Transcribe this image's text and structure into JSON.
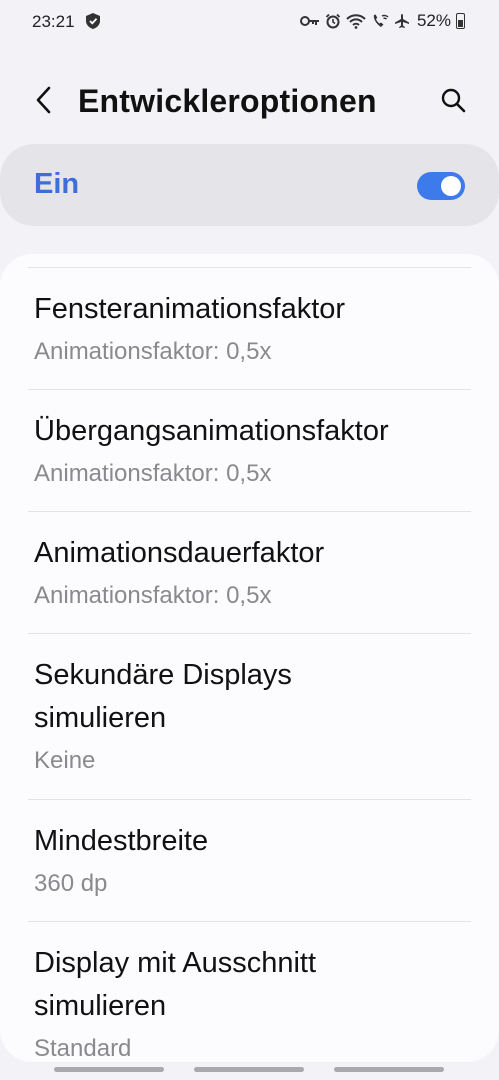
{
  "status_bar": {
    "time": "23:21",
    "battery": "52%",
    "icons": [
      "shield-icon",
      "key-icon",
      "alarm-icon",
      "wifi-icon",
      "wifi-call-icon",
      "airplane-icon",
      "battery-icon"
    ]
  },
  "header": {
    "title": "Entwickleroptionen",
    "back_icon": "chevron-left-icon",
    "search_icon": "search-icon"
  },
  "master_switch": {
    "label": "Ein",
    "state": "on",
    "accent_color": "#3e7bea"
  },
  "settings": [
    {
      "title": "Fensteranimationsfaktor",
      "subtitle": "Animationsfaktor: 0,5x"
    },
    {
      "title": "Übergangsanimationsfaktor",
      "subtitle": "Animationsfaktor: 0,5x"
    },
    {
      "title": "Animationsdauerfaktor",
      "subtitle": "Animationsfaktor: 0,5x"
    },
    {
      "title": "Sekundäre Displays simulieren",
      "subtitle": "Keine"
    },
    {
      "title": "Mindestbreite",
      "subtitle": "360 dp"
    },
    {
      "title": "Display mit Ausschnitt simulieren",
      "subtitle": "Standard"
    }
  ]
}
